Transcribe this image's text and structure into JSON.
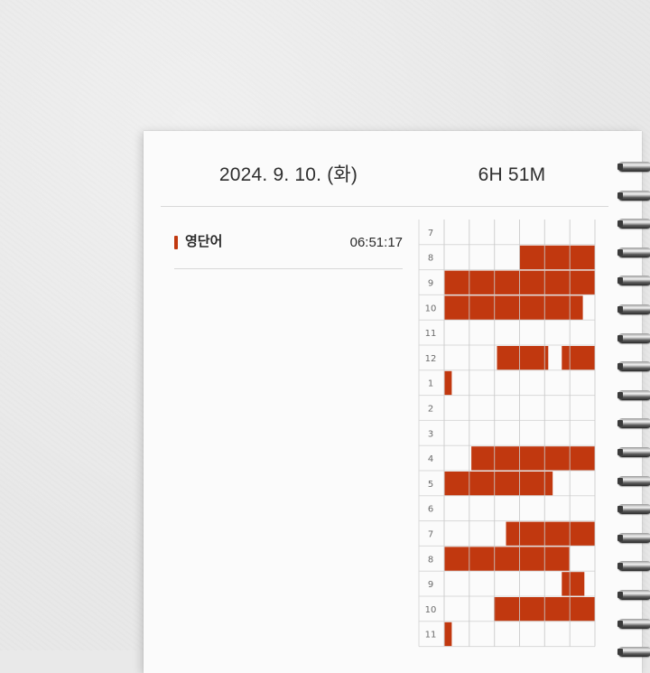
{
  "date": "2024. 9. 10. (화)",
  "total_time": "6H 51M",
  "subject": {
    "name": "영단어",
    "time": "06:51:17",
    "color": "#c1380f"
  },
  "timetable": {
    "hour_labels": [
      "7",
      "8",
      "9",
      "10",
      "11",
      "12",
      "1",
      "2",
      "3",
      "4",
      "5",
      "6",
      "7",
      "8",
      "9",
      "10",
      "11"
    ],
    "columns_per_hour": 6,
    "accent_color": "#c1380f",
    "rows": [
      [],
      [
        [
          0.5,
          1.0
        ]
      ],
      [
        [
          0.0,
          1.0
        ]
      ],
      [
        [
          0.0,
          0.92
        ]
      ],
      [],
      [
        [
          0.35,
          0.69
        ],
        [
          0.78,
          1.0
        ]
      ],
      [
        [
          0.0,
          0.05
        ]
      ],
      [],
      [],
      [
        [
          0.18,
          1.0
        ]
      ],
      [
        [
          0.0,
          0.72
        ]
      ],
      [],
      [
        [
          0.41,
          1.0
        ]
      ],
      [
        [
          0.0,
          0.83
        ]
      ],
      [
        [
          0.78,
          0.93
        ]
      ],
      [
        [
          0.33,
          1.0
        ]
      ],
      [
        [
          0.0,
          0.05
        ]
      ]
    ]
  }
}
